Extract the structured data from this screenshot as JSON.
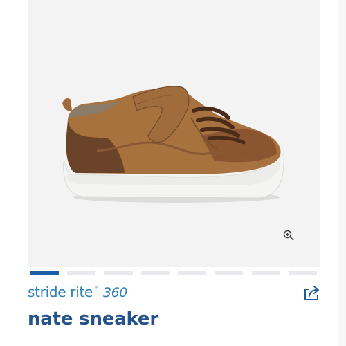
{
  "product": {
    "brand_name": "stride rite",
    "brand_tm": "™",
    "brand_suffix": "360",
    "title": "nate sneaker"
  },
  "gallery": {
    "image_icon": "sneaker-image",
    "zoom_icon": "zoom-in-icon",
    "active_index": 0,
    "total_images": 8
  },
  "actions": {
    "share_icon": "share-icon"
  },
  "colors": {
    "brand": "#2e80b0",
    "title": "#24528b",
    "pager_active": "#1b5fa6",
    "pager_inactive": "#e9e9ee",
    "gallery_bg": "#f3f3f3"
  }
}
